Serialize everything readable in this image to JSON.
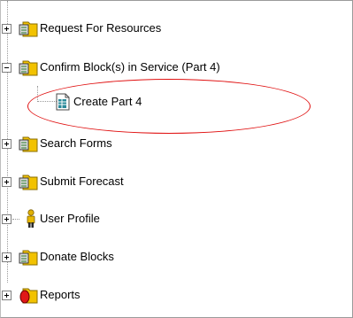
{
  "tree": {
    "items": [
      {
        "label": "Request For Resources",
        "icon": "folder-form-icon",
        "expander": "plus"
      },
      {
        "label": "Confirm Block(s) in Service (Part 4)",
        "icon": "folder-form-icon",
        "expander": "minus"
      },
      {
        "label": "Create Part 4",
        "icon": "document-icon",
        "expander": "none"
      },
      {
        "label": "Search Forms",
        "icon": "folder-form-icon",
        "expander": "plus"
      },
      {
        "label": "Submit Forecast",
        "icon": "folder-form-icon",
        "expander": "plus"
      },
      {
        "label": "User Profile",
        "icon": "user-icon",
        "expander": "plus"
      },
      {
        "label": "Donate Blocks",
        "icon": "folder-form-icon",
        "expander": "plus"
      },
      {
        "label": "Reports",
        "icon": "folder-reports-icon",
        "expander": "plus"
      }
    ]
  },
  "colors": {
    "highlight_oval": "#e01010",
    "folder": "#f2c200",
    "tree_line": "#9a9a9a"
  }
}
